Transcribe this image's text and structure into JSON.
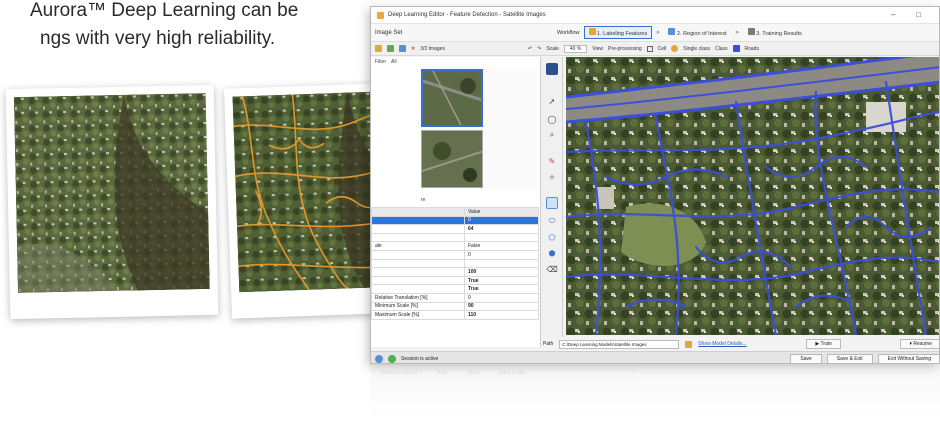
{
  "hero": {
    "line1": "Aurora™ Deep Learning can be",
    "line2": "ngs with very high reliability."
  },
  "window": {
    "title": "Deep Learning Editor - Feature Detection - Satellite Images",
    "controls": {
      "minimize": "–",
      "maximize": "□"
    }
  },
  "toolbar": {
    "image_set_label": "Image Set",
    "workflow_label": "Workflow",
    "steps": [
      {
        "label": "1. Labeling Features",
        "active": true
      },
      {
        "label": "2. Region of Interest",
        "active": false
      },
      {
        "label": "3. Training Results",
        "active": false
      }
    ]
  },
  "toolbar2": {
    "image_count": "3/3 Images",
    "filter_label": "Filter",
    "filter_value": "All",
    "scale_label": "Scale",
    "scale_value": "40 %",
    "view_label": "View",
    "view_value": "Pre-processing",
    "cell_label": "Cell",
    "single_class_label": "Single class",
    "class_label": "Class",
    "class_value": "Roads",
    "class_color": "#3b4fd8"
  },
  "left_panel": {
    "section_label": "re",
    "properties_header": {
      "name": "",
      "value": "Value"
    },
    "properties": [
      {
        "name": "",
        "value": "0",
        "selected": true
      },
      {
        "name": "",
        "value": "64",
        "selected": false
      },
      {
        "name": "",
        "value": "",
        "selected": false
      },
      {
        "name": "ale",
        "value": "False",
        "selected": false
      },
      {
        "name": "",
        "value": "0",
        "selected": false
      },
      {
        "name": "",
        "value": "",
        "selected": false
      },
      {
        "name": "",
        "value": "100",
        "selected": false
      },
      {
        "name": "",
        "value": "True",
        "selected": false
      },
      {
        "name": "",
        "value": "True",
        "selected": false
      },
      {
        "name": "Relative Translation [%]",
        "value": "0",
        "selected": false
      },
      {
        "name": "Minimum Scale [%]",
        "value": "90",
        "selected": false
      },
      {
        "name": "Maximum Scale [%]",
        "value": "110",
        "selected": false
      }
    ]
  },
  "path_bar": {
    "label": "Path",
    "value": "C:\\Deep Learning Models\\Satellite Images",
    "link": "Show Model Details...",
    "train": "Train",
    "resume": "Resume"
  },
  "status_bar": {
    "text": "Session is active",
    "buttons": [
      "Save",
      "Save & Exit",
      "Exit Without Saving"
    ]
  },
  "colors": {
    "accent": "#2e73d6",
    "road_overlay": "#3b4fd8",
    "label_overlay": "#e89a2b"
  }
}
